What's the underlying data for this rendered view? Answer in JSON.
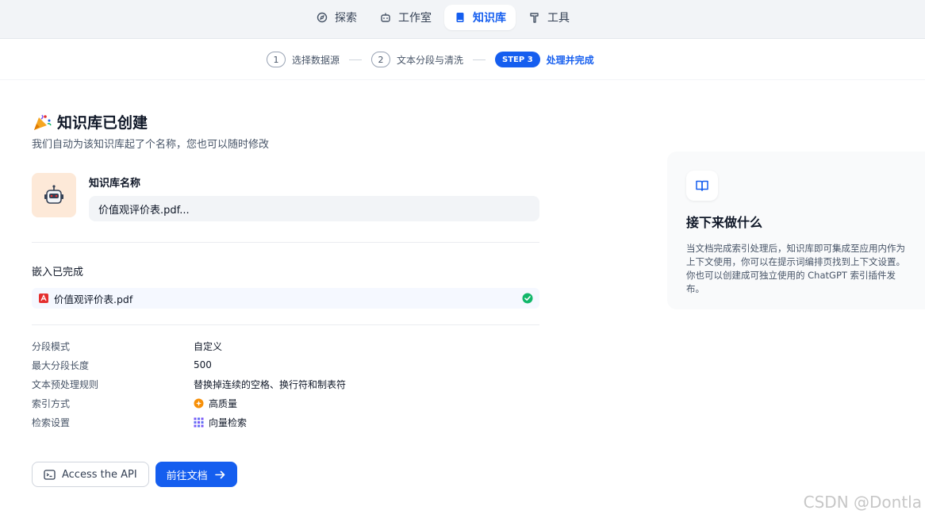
{
  "nav": {
    "items": [
      {
        "label": "探索",
        "icon": "compass-icon"
      },
      {
        "label": "工作室",
        "icon": "robot-icon"
      },
      {
        "label": "知识库",
        "icon": "book-icon"
      },
      {
        "label": "工具",
        "icon": "hammer-icon"
      }
    ],
    "active": "知识库"
  },
  "stepper": {
    "steps": [
      {
        "num": "1",
        "label": "选择数据源"
      },
      {
        "num": "2",
        "label": "文本分段与清洗"
      },
      {
        "num": "STEP 3",
        "label": "处理并完成"
      }
    ],
    "active_step": 3
  },
  "main": {
    "title": "知识库已创建",
    "subtitle": "我们自动为该知识库起了个名称，您也可以随时修改",
    "name_label": "知识库名称",
    "name_value": "价值观评价表.pdf...",
    "embedding_title": "嵌入已完成",
    "file_name": "价值观评价表.pdf",
    "file_status": "completed",
    "info": [
      {
        "key": "分段模式",
        "value": "自定义"
      },
      {
        "key": "最大分段长度",
        "value": "500"
      },
      {
        "key": "文本预处理规则",
        "value": "替换掉连续的空格、换行符和制表符"
      },
      {
        "key": "索引方式",
        "value": "高质量",
        "icon": "high-quality-icon"
      },
      {
        "key": "检索设置",
        "value": "向量检索",
        "icon": "vector-grid-icon"
      }
    ],
    "api_button": "Access the API",
    "docs_button": "前往文档"
  },
  "side": {
    "title": "接下来做什么",
    "text": "当文档完成索引处理后，知识库即可集成至应用内作为上下文使用，你可以在提示词编排页找到上下文设置。你也可以创建成可独立使用的 ChatGPT 索引插件发布。"
  },
  "watermark": "CSDN @Dontla",
  "colors": {
    "accent": "#155eef",
    "success": "#12b76a",
    "pdf": "#e42f2f"
  }
}
